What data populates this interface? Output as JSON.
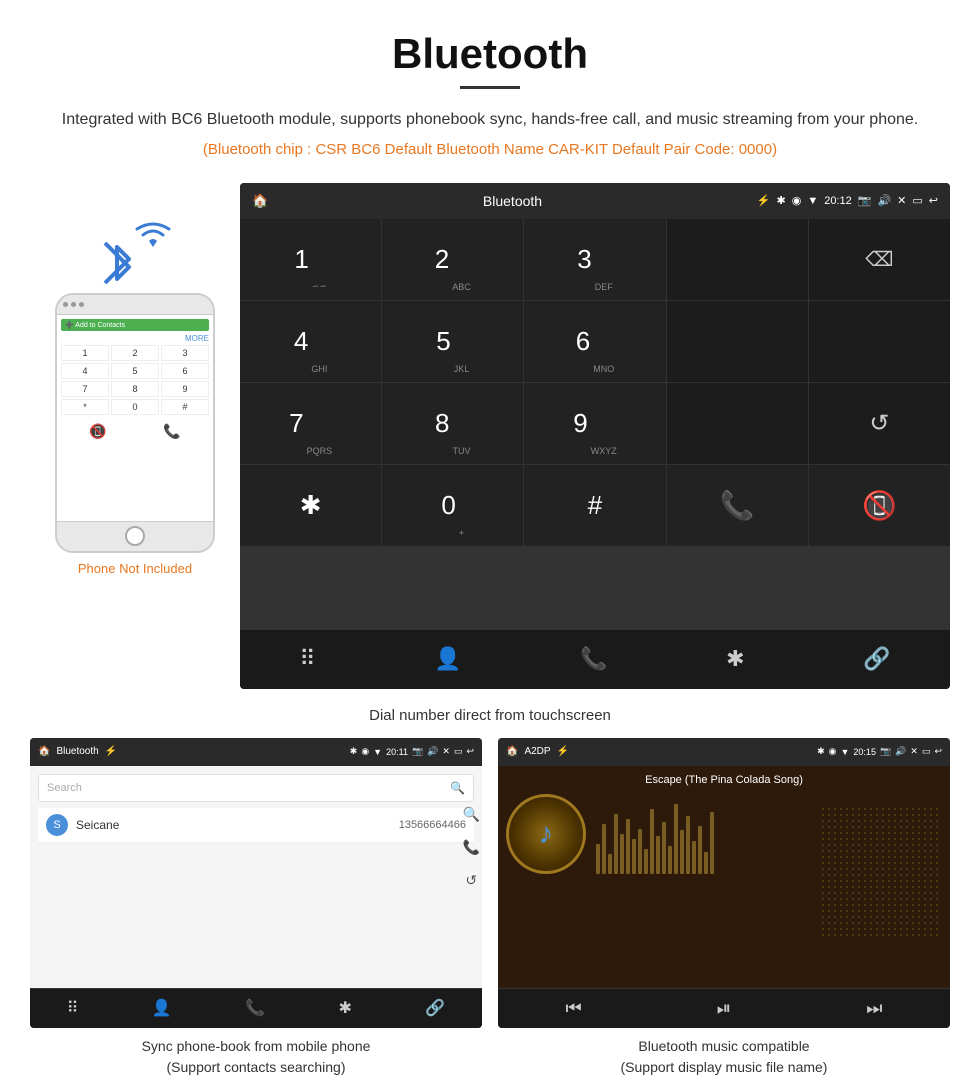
{
  "header": {
    "title": "Bluetooth",
    "description": "Integrated with BC6 Bluetooth module, supports phonebook sync, hands-free call, and music streaming from your phone.",
    "specs": "(Bluetooth chip : CSR BC6    Default Bluetooth Name CAR-KIT    Default Pair Code: 0000)"
  },
  "main_screen": {
    "status_bar": {
      "title": "Bluetooth",
      "time": "20:12"
    },
    "dial_pad": {
      "keys": [
        {
          "num": "1",
          "sub": "∽∽"
        },
        {
          "num": "2",
          "sub": "ABC"
        },
        {
          "num": "3",
          "sub": "DEF"
        },
        {
          "num": "",
          "sub": ""
        },
        {
          "num": "",
          "sub": "backspace"
        },
        {
          "num": "4",
          "sub": "GHI"
        },
        {
          "num": "5",
          "sub": "JKL"
        },
        {
          "num": "6",
          "sub": "MNO"
        },
        {
          "num": "",
          "sub": ""
        },
        {
          "num": "",
          "sub": ""
        },
        {
          "num": "7",
          "sub": "PQRS"
        },
        {
          "num": "8",
          "sub": "TUV"
        },
        {
          "num": "9",
          "sub": "WXYZ"
        },
        {
          "num": "",
          "sub": ""
        },
        {
          "num": "",
          "sub": "refresh"
        },
        {
          "num": "*",
          "sub": ""
        },
        {
          "num": "0",
          "sub": "+"
        },
        {
          "num": "#",
          "sub": ""
        },
        {
          "num": "",
          "sub": "call-green"
        },
        {
          "num": "",
          "sub": "call-red"
        }
      ]
    }
  },
  "caption_main": "Dial number direct from touchscreen",
  "phone_mockup": {
    "not_included": "Phone Not Included",
    "contact_label": "Add to Contacts"
  },
  "phonebook_screen": {
    "status_title": "Bluetooth",
    "time": "20:11",
    "search_placeholder": "Search",
    "contact": {
      "initial": "S",
      "name": "Seicane",
      "phone": "13566664466"
    }
  },
  "music_screen": {
    "status_title": "A2DP",
    "time": "20:15",
    "song_title": "Escape (The Pina Colada Song)"
  },
  "captions": {
    "phonebook": "Sync phone-book from mobile phone\n(Support contacts searching)",
    "music": "Bluetooth music compatible\n(Support display music file name)"
  },
  "bottom_icons": {
    "phonebook_sidebar": [
      "🔍",
      "📞",
      "🔄"
    ],
    "phonebook_bottom": [
      "⠿",
      "👤",
      "📞",
      "✱",
      "🔗"
    ],
    "music_controls": [
      "⏮",
      "⏯",
      "⏭"
    ]
  }
}
